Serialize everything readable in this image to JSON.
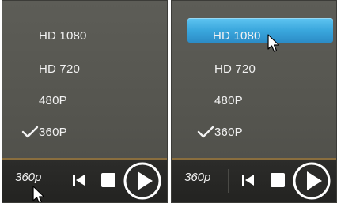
{
  "panels": [
    {
      "menu": {
        "items": [
          {
            "label": "HD 1080"
          },
          {
            "label": "HD 720"
          },
          {
            "label": "480P"
          },
          {
            "label": "360P"
          }
        ],
        "selected_index": 3,
        "hovered_index": null
      },
      "controls": {
        "quality_label": "360p",
        "icons": [
          "skip-back-icon",
          "stop-icon",
          "play-icon"
        ]
      }
    },
    {
      "menu": {
        "items": [
          {
            "label": "HD 1080"
          },
          {
            "label": "HD 720"
          },
          {
            "label": "480P"
          },
          {
            "label": "360P"
          }
        ],
        "selected_index": 3,
        "hovered_index": 0
      },
      "controls": {
        "quality_label": "360p",
        "icons": [
          "skip-back-icon",
          "stop-icon",
          "play-icon"
        ]
      }
    }
  ],
  "colors": {
    "panel_bg": "#55554f",
    "hover_accent": "#3aa7dd",
    "control_bar": "#262624",
    "text": "#f2f2f2"
  }
}
